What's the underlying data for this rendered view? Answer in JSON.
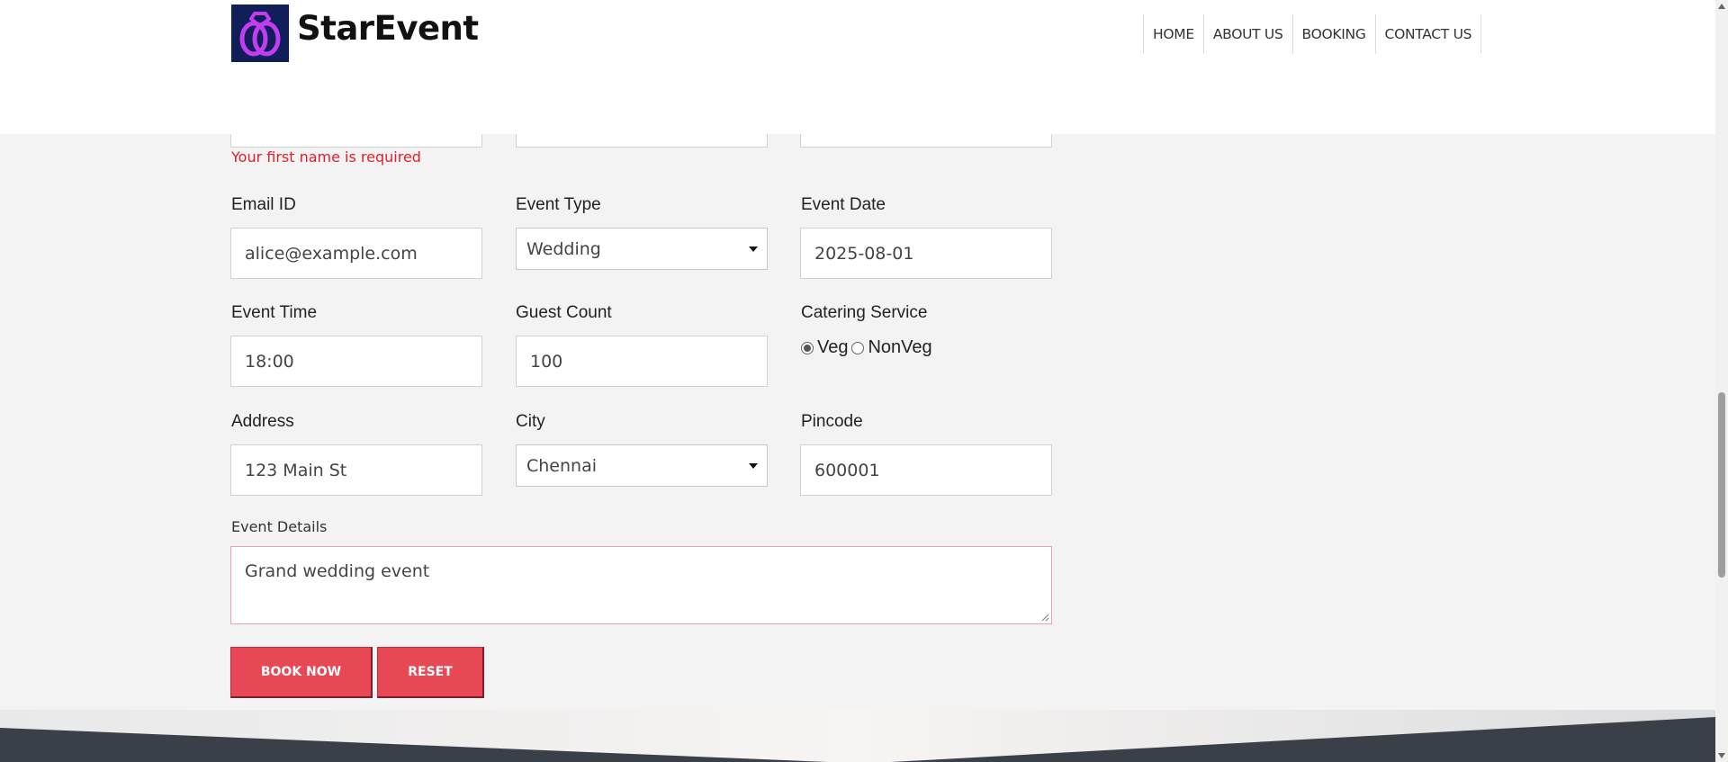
{
  "header": {
    "brand": "StarEvent",
    "nav": [
      "HOME",
      "ABOUT US",
      "BOOKING",
      "CONTACT US"
    ]
  },
  "form": {
    "first_name_error": "Your first name is required",
    "email": {
      "label": "Email ID",
      "value": "alice@example.com"
    },
    "event_type": {
      "label": "Event Type",
      "value": "Wedding"
    },
    "event_date": {
      "label": "Event Date",
      "value": "2025-08-01"
    },
    "event_time": {
      "label": "Event Time",
      "value": "18:00"
    },
    "guest_count": {
      "label": "Guest Count",
      "value": "100"
    },
    "catering": {
      "label": "Catering Service",
      "options": [
        "Veg",
        "NonVeg"
      ],
      "selected": "Veg"
    },
    "address": {
      "label": "Address",
      "value": "123 Main St"
    },
    "city": {
      "label": "City",
      "value": "Chennai"
    },
    "pincode": {
      "label": "Pincode",
      "value": "600001"
    },
    "details": {
      "label": "Event Details",
      "value": "Grand wedding event"
    },
    "book_label": "BOOK NOW",
    "reset_label": "RESET"
  },
  "colors": {
    "accent": "#e84855",
    "error": "#e0202a",
    "logo_bg": "#101f5a",
    "logo_ring": "#c23cf0"
  }
}
